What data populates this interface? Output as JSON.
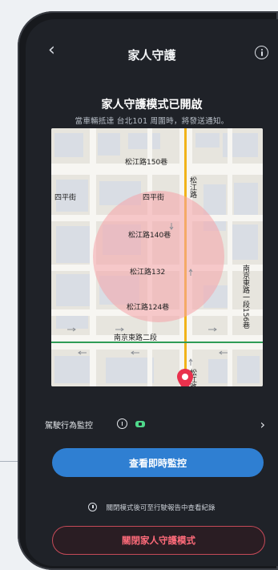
{
  "header": {
    "title": "家人守護",
    "back_icon": "back-arrow-icon",
    "info_icon": "info-icon"
  },
  "status": {
    "title": "家人守護模式已開啟",
    "subtitle": "當車輛抵達 台北101 周圍時，將發送通知。"
  },
  "map": {
    "labels": [
      "松江路150巷",
      "四平街",
      "四平街",
      "松江路140巷",
      "松江路132",
      "松江路124巷",
      "南京東路二段",
      "松江路",
      "松江路",
      "南京東路一段156巷"
    ],
    "accent_color": "#e9314d"
  },
  "monitor": {
    "label": "駕駛行為監控",
    "info_icon": "info-icon",
    "badge_icon": "status-badge-icon",
    "chevron": "›"
  },
  "actions": {
    "primary_label": "查看即時監控",
    "note": "關閉模式後可至行駛報告中查看紀錄",
    "danger_label": "關閉家人守護模式"
  },
  "colors": {
    "primary": "#2f7fd2",
    "danger": "#ff6b7a",
    "background": "#1f2228"
  }
}
